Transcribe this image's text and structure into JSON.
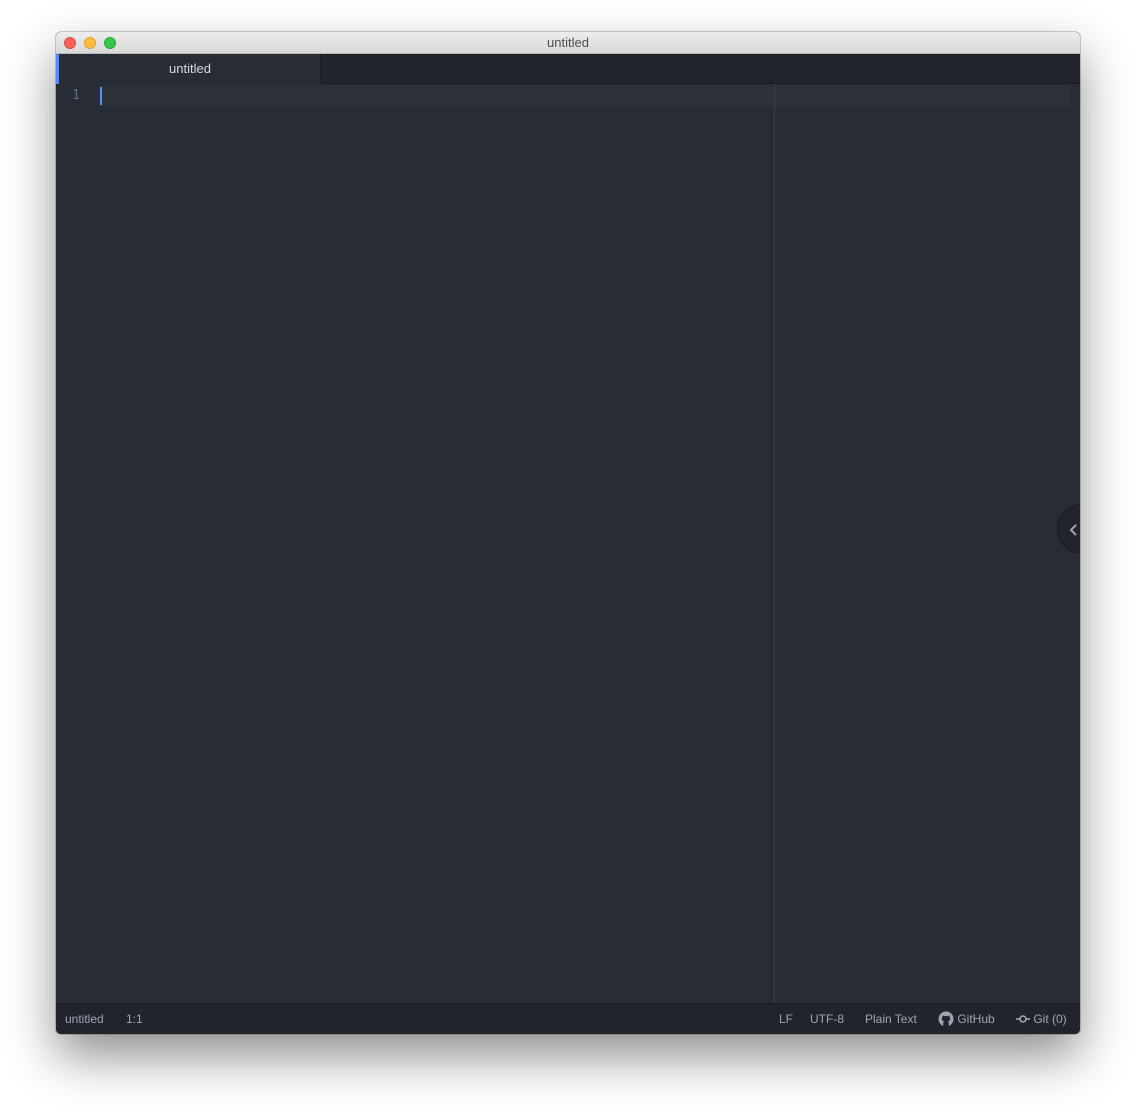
{
  "window": {
    "title": "untitled"
  },
  "tabs": [
    {
      "label": "untitled",
      "active": true
    }
  ],
  "editor": {
    "line_numbers": [
      "1"
    ],
    "content": ""
  },
  "statusbar": {
    "file_name": "untitled",
    "cursor_position": "1:1",
    "line_ending": "LF",
    "encoding": "UTF-8",
    "grammar": "Plain Text",
    "github_label": "GitHub",
    "git_label": "Git (0)"
  },
  "icons": {
    "dock_toggle": "chevron-left-icon",
    "github": "github-icon",
    "git": "git-commit-icon"
  },
  "colors": {
    "accent": "#568af2",
    "editor_background": "#282c34",
    "chrome_background": "#21252b",
    "close": "#fc605c",
    "minimize": "#fdbc40",
    "zoom": "#34c84a"
  }
}
